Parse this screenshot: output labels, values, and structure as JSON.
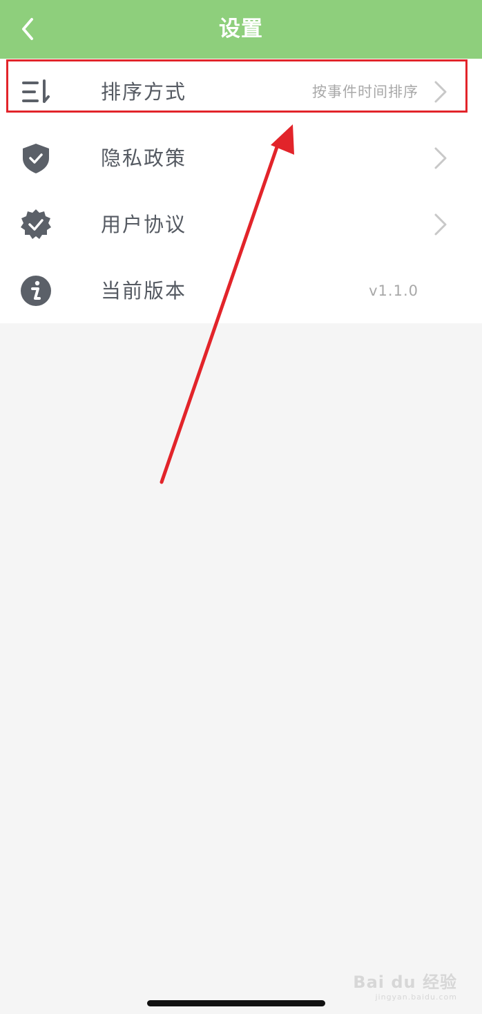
{
  "navbar": {
    "title": "设置",
    "back_icon": "chevron-left-icon"
  },
  "settings": [
    {
      "label": "排序方式",
      "value": "按事件时间排序",
      "icon": "sort-list-icon",
      "has_chevron": true
    },
    {
      "label": "隐私政策",
      "value": "",
      "icon": "shield-check-icon",
      "has_chevron": true
    },
    {
      "label": "用户协议",
      "value": "",
      "icon": "badge-check-icon",
      "has_chevron": true
    },
    {
      "label": "当前版本",
      "value": "v1.1.0",
      "icon": "info-icon",
      "has_chevron": false
    }
  ],
  "watermark": {
    "main": "Bai du 经验",
    "sub": "jingyan.baidu.com"
  },
  "colors": {
    "navbar": "#8ecf7c",
    "icon": "#5b6068",
    "highlight": "#e2242a",
    "background": "#f5f5f5"
  }
}
